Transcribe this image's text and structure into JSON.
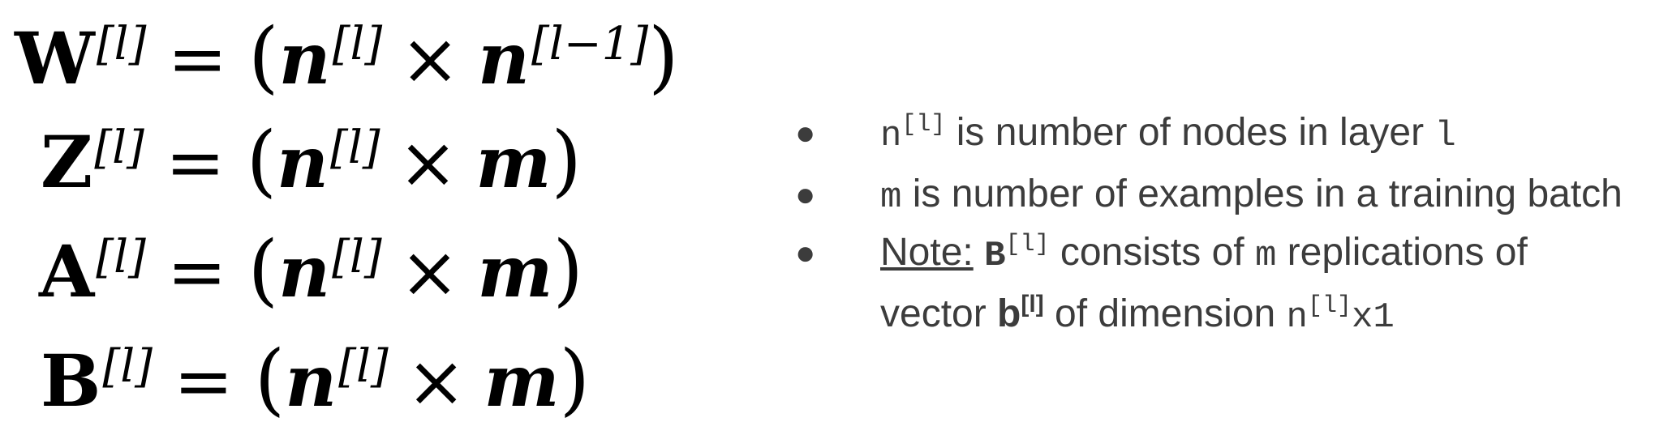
{
  "equations": [
    {
      "symbol": "W",
      "superscript": "[l]",
      "equals": "=",
      "open": "(",
      "a": "n",
      "a_sup": "[l]",
      "times": "×",
      "b": "n",
      "b_sup": "[l−1]",
      "close": ")"
    },
    {
      "symbol": "Z",
      "superscript": "[l]",
      "equals": "=",
      "open": "(",
      "a": "n",
      "a_sup": "[l]",
      "times": "×",
      "b": "m",
      "close": ")"
    },
    {
      "symbol": "A",
      "superscript": "[l]",
      "equals": "=",
      "open": "(",
      "a": "n",
      "a_sup": "[l]",
      "times": "×",
      "b": "m",
      "close": ")"
    },
    {
      "symbol": "B",
      "superscript": "[l]",
      "equals": "=",
      "open": "(",
      "a": "n",
      "a_sup": "[l]",
      "times": "×",
      "b": "m",
      "close": ")"
    }
  ],
  "bullets": {
    "b1": {
      "dot": "●",
      "code1": "n",
      "code1_sup": "[l]",
      "text1": " is number of nodes in layer ",
      "code2": "l"
    },
    "b2": {
      "dot": "●",
      "code1": "m",
      "text1": " is number of examples in a training batch"
    },
    "b3": {
      "dot": "●",
      "note": "Note:",
      "code1": "B",
      "code1_sup": "[l]",
      "text1": " consists of ",
      "code2": "m",
      "text2": " replications of vector ",
      "bold": "b",
      "bold_sup": "[l]",
      "text3": " of dimension ",
      "code3": "n",
      "code3_sup": "[l]",
      "code3_tail": "x1"
    }
  }
}
